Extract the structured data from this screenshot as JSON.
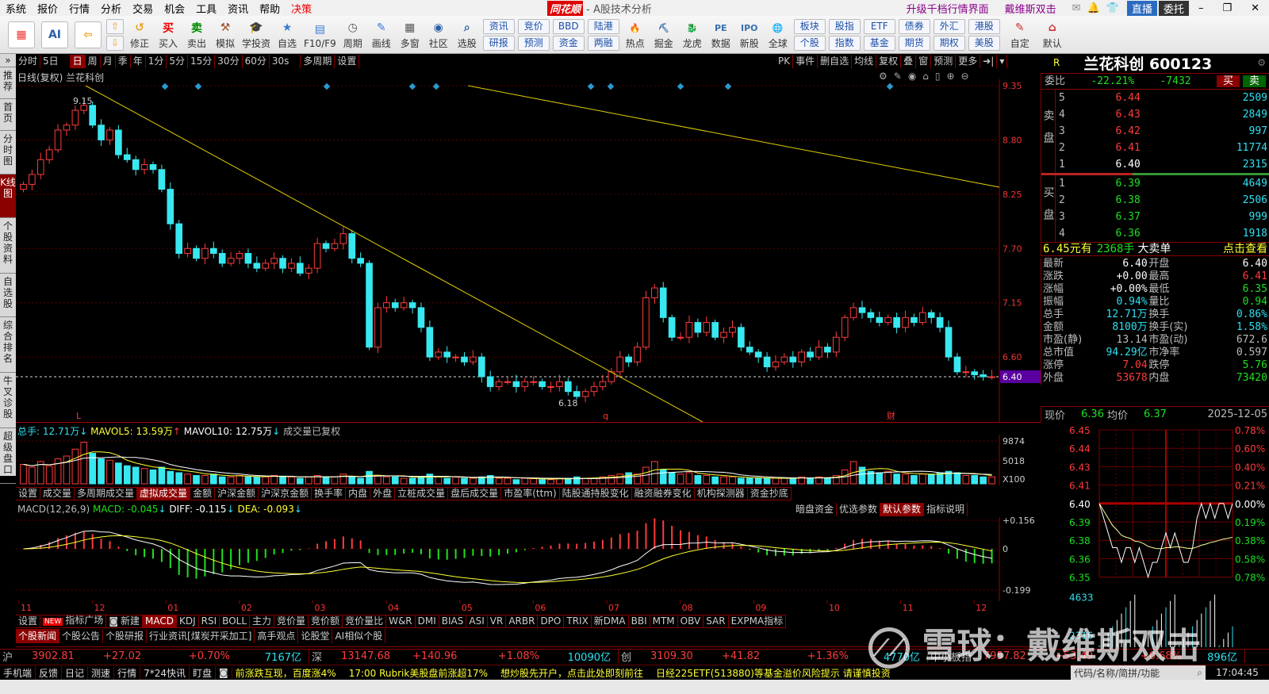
{
  "menu": [
    "系统",
    "报价",
    "行情",
    "分析",
    "交易",
    "机会",
    "工具",
    "资讯",
    "帮助",
    "决策"
  ],
  "app": {
    "logo": "同花顺",
    "title": "- A股技术分析",
    "promo1": "升级千档行情界面",
    "promo2": "戴维斯双击",
    "live": "直播",
    "entrust": "委托"
  },
  "toolbar": {
    "buttons": [
      "修正",
      "买入",
      "卖出",
      "模拟",
      "学投资",
      "自选",
      "F10/F9",
      "周期",
      "画线",
      "多窗",
      "社区",
      "选股"
    ],
    "pairs": [
      [
        "资讯",
        "研报"
      ],
      [
        "竞价",
        "预测"
      ],
      [
        "BBD",
        "资金"
      ],
      [
        "陆港",
        "两融"
      ]
    ],
    "buttons2": [
      "热点",
      "掘金",
      "龙虎",
      "数据",
      "新股",
      "全球"
    ],
    "pairs2": [
      [
        "板块",
        "个股"
      ],
      [
        "股指",
        "指数"
      ],
      [
        "ETF",
        "基金"
      ],
      [
        "债券",
        "期货"
      ],
      [
        "外汇",
        "期权"
      ],
      [
        "港股",
        "美股"
      ]
    ],
    "buttons3": [
      "自定",
      "默认"
    ]
  },
  "sidebar": [
    "推荐",
    "首页",
    "分时图",
    "K线图",
    "个股资料",
    "自选股",
    "综合排名",
    "牛叉诊股",
    "超级盘口"
  ],
  "periods": [
    "分时",
    "5日",
    "日",
    "周",
    "月",
    "季",
    "年",
    "1分",
    "5分",
    "15分",
    "30分",
    "60分",
    "30s",
    "多周期",
    "设置"
  ],
  "chart_tools": [
    "PK",
    "事件",
    "删自选",
    "均线",
    "复权",
    "叠",
    "窗",
    "预测",
    "更多"
  ],
  "chart": {
    "header": "日线(复权)  兰花科创",
    "high_label": "9.15",
    "low_label": "6.18",
    "markers": [
      "L",
      "q",
      "财"
    ],
    "price_ticks": [
      "9.35",
      "8.80",
      "8.25",
      "7.70",
      "7.15",
      "6.60"
    ],
    "current_price": "6.40"
  },
  "chart_data": {
    "type": "candlestick",
    "title": "兰花科创 日线(复权)",
    "months": [
      "11",
      "12",
      "01",
      "02",
      "03",
      "04",
      "05",
      "06",
      "07",
      "08",
      "09",
      "10",
      "11",
      "12"
    ],
    "ylim": [
      6.0,
      9.35
    ],
    "closes": [
      8.35,
      8.45,
      8.6,
      8.7,
      8.9,
      8.95,
      9.1,
      9.15,
      8.95,
      8.8,
      8.9,
      8.65,
      8.6,
      8.5,
      8.55,
      8.5,
      8.3,
      7.95,
      7.65,
      7.7,
      7.6,
      7.7,
      7.65,
      7.55,
      7.6,
      7.65,
      7.55,
      7.5,
      7.55,
      7.6,
      7.5,
      7.55,
      7.45,
      7.5,
      7.75,
      7.7,
      7.75,
      7.85,
      7.6,
      7.55,
      6.7,
      7.1,
      7.15,
      7.1,
      7.15,
      7.1,
      6.9,
      6.6,
      6.65,
      6.6,
      6.6,
      6.55,
      6.6,
      6.4,
      6.3,
      6.35,
      6.35,
      6.3,
      6.35,
      6.35,
      6.3,
      6.3,
      6.35,
      6.25,
      6.2,
      6.25,
      6.3,
      6.35,
      6.45,
      6.6,
      6.55,
      6.7,
      7.2,
      7.3,
      7.0,
      6.8,
      6.8,
      6.95,
      6.85,
      6.95,
      6.8,
      6.85,
      6.9,
      6.7,
      6.65,
      6.6,
      6.5,
      6.55,
      6.6,
      6.55,
      6.65,
      6.6,
      6.7,
      6.65,
      6.8,
      7.0,
      7.1,
      7.05,
      7.0,
      6.95,
      7.0,
      6.9,
      7.0,
      6.95,
      7.05,
      7.0,
      6.9,
      6.6,
      6.45,
      6.45,
      6.42,
      6.4,
      6.4
    ],
    "volumes": [
      14,
      12,
      16,
      13,
      18,
      20,
      25,
      30,
      22,
      18,
      17,
      15,
      13,
      12,
      11,
      10,
      12,
      9,
      8,
      7,
      6,
      6,
      7,
      5,
      5,
      6,
      5,
      5,
      5,
      6,
      5,
      5,
      4,
      5,
      6,
      5,
      5,
      7,
      5,
      4,
      9,
      6,
      5,
      5,
      4,
      4,
      5,
      7,
      5,
      4,
      5,
      4,
      4,
      5,
      6,
      4,
      4,
      3,
      4,
      4,
      3,
      3,
      4,
      4,
      5,
      4,
      4,
      5,
      6,
      7,
      8,
      7,
      12,
      16,
      10,
      8,
      7,
      8,
      6,
      6,
      5,
      5,
      5,
      4,
      4,
      4,
      4,
      4,
      4,
      4,
      5,
      4,
      5,
      4,
      6,
      10,
      16,
      12,
      9,
      8,
      9,
      7,
      7,
      6,
      7,
      7,
      8,
      9,
      8,
      6,
      6,
      5,
      5
    ],
    "vol_ticks": [
      "9874",
      "5018",
      "X100"
    ],
    "macd_ticks": [
      "+0.156",
      "0",
      "-0.199"
    ]
  },
  "vol": {
    "total": "总手: 12.71万",
    "mavol5": "MAVOL5: 13.59万",
    "mavol10": "MAVOL10: 12.75万",
    "note": "成交量已复权"
  },
  "vol_tabs": [
    "设置",
    "成交量",
    "多周期成交量",
    "虚拟成交量",
    "金额",
    "沪深金额",
    "沪深京金额",
    "换手率",
    "内盘",
    "外盘",
    "立桩成交量",
    "盘后成交量",
    "市盈率(ttm)",
    "陆股通持股变化",
    "融资融券变化",
    "机构探测器",
    "资金抄底"
  ],
  "macd": {
    "label": "MACD(12,26,9)",
    "macd": "MACD: -0.045",
    "diff": "DIFF: -0.115",
    "dea": "DEA: -0.093",
    "tabs": [
      "暗盘资金",
      "优选参数",
      "默认参数",
      "指标说明"
    ]
  },
  "ind_tabs": [
    "设置",
    "指标广场",
    "新建",
    "MACD",
    "KDJ",
    "RSI",
    "BOLL",
    "主力",
    "竞价量",
    "竞价额",
    "竞价量比",
    "W&R",
    "DMI",
    "BIAS",
    "ASI",
    "VR",
    "ARBR",
    "DPO",
    "TRIX",
    "新DMA",
    "BBI",
    "MTM",
    "OBV",
    "SAR",
    "EXPMA指标"
  ],
  "new_badge": "NEW",
  "news_tabs": [
    "个股新闻",
    "个股公告",
    "个股研报",
    "行业资讯[煤炭开采加工]",
    "高手观点",
    "论股堂",
    "AI相似个股"
  ],
  "indices": [
    {
      "name": "沪",
      "price": "3902.81",
      "chg": "+27.02",
      "pct": "+0.70%",
      "amt": "7167亿"
    },
    {
      "name": "深",
      "price": "13147.68",
      "chg": "+140.96",
      "pct": "+1.08%",
      "amt": "10090亿"
    },
    {
      "name": "创",
      "price": "3109.30",
      "chg": "+41.82",
      "pct": "+1.36%",
      "amt": "4770亿"
    },
    {
      "name": "中小板指",
      "price": "7957.82",
      "chg": "+53.49",
      "pct": "+0.68%",
      "amt": "896亿"
    }
  ],
  "status": {
    "items": [
      "手机端",
      "反馈",
      "日记",
      "测速",
      "行情",
      "7*24快讯",
      "盯盘"
    ],
    "ticker": [
      "前涨跌互现，百度涨4%",
      "17:00 Rubrik美股盘前涨超17%",
      "想炒股先开户，点击此处即刻前往",
      "日经225ETF(513880)等基金溢价风险提示 请谨慎投资"
    ],
    "search_placeholder": "代码/名称/简拼/功能",
    "time": "17:04:45"
  },
  "quote": {
    "flag": "R",
    "name": "兰花科创 600123",
    "weibi_label": "委比",
    "weibi": "-22.21%",
    "weicha": "-7432",
    "buy": "买",
    "sell": "卖",
    "sell_label": "卖盘",
    "buy_label": "买盘",
    "asks": [
      [
        "5",
        "6.44",
        "2509"
      ],
      [
        "4",
        "6.43",
        "2849"
      ],
      [
        "3",
        "6.42",
        "997"
      ],
      [
        "2",
        "6.41",
        "11774"
      ],
      [
        "1",
        "6.40",
        "2315"
      ]
    ],
    "bids": [
      [
        "1",
        "6.39",
        "4649"
      ],
      [
        "2",
        "6.38",
        "2506"
      ],
      [
        "3",
        "6.37",
        "999"
      ],
      [
        "4",
        "6.36",
        "1918"
      ]
    ],
    "bigorder": {
      "price": "6.45",
      "t1": "元有",
      "qty": "2368手",
      "t2": "大卖单",
      "link": "点击查看"
    },
    "stats": [
      [
        "最新",
        "6.40",
        "开盘",
        "6.40"
      ],
      [
        "涨跌",
        "+0.00",
        "最高",
        "6.41"
      ],
      [
        "涨幅",
        "+0.00%",
        "最低",
        "6.35"
      ],
      [
        "振幅",
        "0.94%",
        "量比",
        "0.94"
      ],
      [
        "总手",
        "12.71万",
        "换手",
        "0.86%"
      ],
      [
        "金额",
        "8100万",
        "换手(实)",
        "1.58%"
      ],
      [
        "市盈(静)",
        "13.14",
        "市盈(动)",
        "672.6"
      ],
      [
        "总市值",
        "94.29亿",
        "市净率",
        "0.597"
      ],
      [
        "涨停",
        "7.04",
        "跌停",
        "5.76"
      ],
      [
        "外盘",
        "53678",
        "内盘",
        "73420"
      ]
    ],
    "now_label": "现价",
    "now": "6.36",
    "avg_label": "均价",
    "avg": "6.37",
    "date": "2025-12-05"
  },
  "intraday": {
    "price_ticks": [
      "6.45",
      "6.44",
      "6.43",
      "6.41",
      "6.40",
      "6.39",
      "6.38",
      "6.36",
      "6.35"
    ],
    "pct_ticks": [
      "0.78%",
      "0.60%",
      "0.40%",
      "0.21%",
      "0.00%",
      "0.19%",
      "0.38%",
      "0.58%",
      "0.78%"
    ],
    "vol_ticks": [
      "4633",
      "2316"
    ],
    "prices": [
      6.4,
      6.39,
      6.38,
      6.37,
      6.37,
      6.36,
      6.37,
      6.37,
      6.36,
      6.37,
      6.36,
      6.35,
      6.36,
      6.36,
      6.37,
      6.38,
      6.37,
      6.38,
      6.37,
      6.36,
      6.36,
      6.37,
      6.39,
      6.4,
      6.39,
      6.4,
      6.39,
      6.4,
      6.4,
      6.39,
      6.4
    ],
    "bottom_tabs": [
      "细",
      "涉",
      "分",
      "筹",
      "估",
      "指",
      "财"
    ]
  },
  "watermark": "雪球：戴维斯双击"
}
